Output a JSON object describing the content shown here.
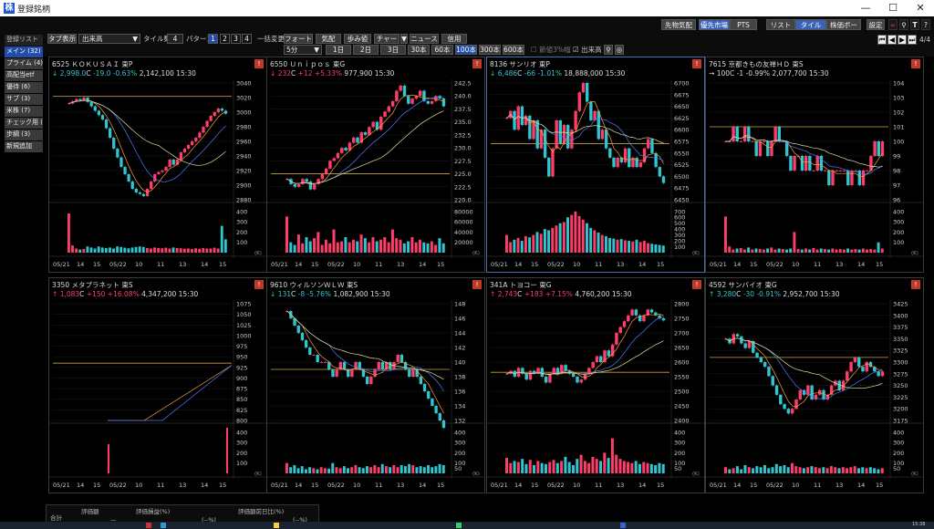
{
  "window": {
    "title": "登録銘柄",
    "minimize": "—",
    "maximize": "☐",
    "close": "✕"
  },
  "appbar": {
    "buttons": [
      "先物気配",
      "優先市場",
      "PTS",
      "リスト",
      "タイル",
      "株価ボード",
      "設定"
    ],
    "active": [
      "優先市場",
      "タイル"
    ],
    "page": "4/4"
  },
  "toolbar": {
    "tab_display_label": "タブ表示",
    "sort_value": "出来高",
    "tile_count_label": "タイル数",
    "tile_count": "4",
    "pattern_label": "パターン",
    "patterns": [
      "1",
      "2",
      "3",
      "4"
    ],
    "bulk_change_label": "一括変更",
    "row1_buttons": [
      "フォート",
      "気配",
      "歩み値",
      "チャート",
      "ニュース",
      "信用"
    ],
    "interval_value": "5分",
    "periods": [
      "1日",
      "2日",
      "3日",
      "30本",
      "60本",
      "100本",
      "300本",
      "600本"
    ],
    "active_period": "100本",
    "checkbox_ma": "節値3%幅",
    "checkbox_volume": "出来高"
  },
  "sidebar": {
    "header": "登録リスト",
    "items": [
      "メイン (32)",
      "プライム (4)",
      "高配当etf",
      "優待 (6)",
      "サブ (3)",
      "米株 (7)",
      "チェック用 (",
      "步綱 (3)"
    ],
    "active_index": 0,
    "add": "新規追加"
  },
  "panels": [
    {
      "code": "6525",
      "name": "ＫＯＫＵＳＡＩ",
      "market": "東P",
      "dir": "↓",
      "price": "2,998.0",
      "pc": "C",
      "change": "-19.0",
      "pct": "-0.63%",
      "volume": "2,142,100",
      "time": "15:30",
      "trend": "dn",
      "y_ticks": [
        "3040",
        "3020",
        "3000",
        "2980",
        "2960",
        "2940",
        "2920",
        "2900",
        "2880"
      ],
      "v_ticks": [
        "400",
        "300",
        "200",
        "100"
      ],
      "x_ticks": [
        "05/21",
        "14",
        "15",
        "05/22",
        "10",
        "11",
        "13",
        "14",
        "15"
      ],
      "base": 3022,
      "series": [
        3012,
        3015,
        3018,
        3016,
        3020,
        3014,
        3008,
        3002,
        2996,
        2990,
        2978,
        2965,
        2950,
        2938,
        2925,
        2915,
        2905,
        2895,
        2890,
        2888,
        2885,
        2895,
        2905,
        2915,
        2918,
        2920,
        2925,
        2935,
        2928,
        2935,
        2945,
        2950,
        2955,
        2960,
        2965,
        2972,
        2980,
        2988,
        2995,
        3000,
        3005,
        3002,
        2998
      ],
      "vols": [
        380,
        70,
        40,
        30,
        35,
        60,
        50,
        40,
        60,
        50,
        45,
        50,
        40,
        60,
        55,
        48,
        42,
        50,
        55,
        60,
        55,
        45,
        40,
        50,
        45,
        42,
        48,
        40,
        50,
        45,
        42,
        38,
        40,
        35,
        42,
        38,
        45,
        40,
        40,
        48,
        40,
        260,
        130
      ]
    },
    {
      "code": "6550",
      "name": "Ｕｎｉｐｏｓ",
      "market": "東G",
      "dir": "↓",
      "price": "232",
      "pc": "C",
      "change": "+12",
      "pct": "+5.33%",
      "volume": "977,900",
      "time": "15:30",
      "trend": "up",
      "y_ticks": [
        "242.5",
        "240.0",
        "237.5",
        "235.0",
        "232.5",
        "230.0",
        "227.5",
        "225.0",
        "222.5",
        "220.0"
      ],
      "v_ticks": [
        "80000",
        "60000",
        "40000",
        "20000"
      ],
      "x_ticks": [
        "05/21",
        "14",
        "15",
        "05/22",
        "10",
        "11",
        "13",
        "14",
        "15"
      ],
      "base": 225,
      "series": [
        224,
        223,
        222.5,
        223,
        224,
        223.5,
        222,
        223,
        224,
        225,
        226,
        227.5,
        228,
        229,
        230,
        229.5,
        231,
        232,
        231,
        233,
        232.5,
        234,
        235,
        233.5,
        236,
        237,
        238,
        239,
        241,
        242,
        240,
        238.5,
        239.5,
        240,
        241,
        239,
        238.5,
        239,
        240,
        239.5,
        238
      ],
      "vols": [
        70000,
        20000,
        15000,
        35000,
        18000,
        30000,
        22000,
        28000,
        40000,
        15000,
        25000,
        18000,
        45000,
        20000,
        22000,
        30000,
        20000,
        25000,
        22000,
        35000,
        28000,
        20000,
        30000,
        22000,
        25000,
        30000,
        20000,
        45000,
        28000,
        25000,
        18000,
        22000,
        30000,
        20000,
        25000,
        20000,
        18000,
        22000,
        15000,
        28000,
        18000
      ]
    },
    {
      "code": "8136",
      "name": "サンリオ",
      "market": "東P",
      "dir": "↓",
      "price": "6,486",
      "pc": "C",
      "change": "-66",
      "pct": "-1.01%",
      "volume": "18,888,000",
      "time": "15:30",
      "trend": "dn",
      "y_ticks": [
        "6700",
        "6675",
        "6650",
        "6625",
        "6600",
        "6575",
        "6550",
        "6525",
        "6500",
        "6475",
        "6450"
      ],
      "v_ticks": [
        "700",
        "600",
        "500",
        "400",
        "300",
        "200",
        "100"
      ],
      "x_ticks": [
        "05/21",
        "14",
        "15",
        "05/22",
        "10",
        "11",
        "13",
        "14",
        "15"
      ],
      "base": 6570,
      "series": [
        6625,
        6640,
        6600,
        6650,
        6610,
        6630,
        6580,
        6620,
        6560,
        6600,
        6540,
        6500,
        6560,
        6620,
        6570,
        6610,
        6560,
        6600,
        6640,
        6680,
        6700,
        6660,
        6620,
        6640,
        6580,
        6600,
        6560,
        6540,
        6520,
        6540,
        6530,
        6560,
        6520,
        6540,
        6520,
        6530,
        6560,
        6580,
        6550,
        6520,
        6500,
        6486
      ],
      "vols": [
        300,
        180,
        220,
        250,
        200,
        280,
        260,
        300,
        350,
        320,
        400,
        380,
        420,
        460,
        500,
        520,
        600,
        640,
        700,
        620,
        560,
        500,
        420,
        380,
        340,
        300,
        280,
        250,
        240,
        220,
        230,
        210,
        200,
        190,
        220,
        180,
        200,
        160,
        150,
        140,
        130,
        120
      ]
    },
    {
      "code": "7615",
      "name": "京都きもの友禅ＨＤ",
      "market": "東S",
      "dir": "→",
      "price": "100",
      "pc": "C",
      "change": "-1",
      "pct": "-0.99%",
      "volume": "2,077,700",
      "time": "15:30",
      "trend": "flat",
      "y_ticks": [
        "104",
        "103",
        "102",
        "101",
        "100",
        "99",
        "98",
        "97",
        "96"
      ],
      "v_ticks": [
        "400",
        "300",
        "200",
        "100"
      ],
      "x_ticks": [
        "05/21",
        "14",
        "15",
        "05/22",
        "10",
        "11",
        "13",
        "14",
        "15"
      ],
      "base": 101,
      "series": [
        100,
        100,
        101,
        100,
        100,
        101,
        100,
        100,
        99,
        100,
        100,
        99,
        100,
        101,
        100,
        100,
        99,
        98,
        99,
        99,
        98,
        99,
        98,
        98,
        99,
        98,
        98,
        97,
        98,
        98,
        98,
        98,
        97,
        98,
        98,
        97,
        98,
        98,
        99,
        100,
        99,
        100
      ],
      "vols": [
        350,
        60,
        30,
        40,
        45,
        30,
        50,
        30,
        40,
        35,
        30,
        40,
        50,
        30,
        40,
        35,
        30,
        40,
        200,
        35,
        30,
        40,
        30,
        45,
        30,
        40,
        35,
        30,
        40,
        30,
        35,
        30,
        40,
        30,
        35,
        30,
        40,
        30,
        35,
        30,
        100,
        40
      ]
    },
    {
      "code": "3350",
      "name": "メタプラネット",
      "market": "東S",
      "dir": "↑",
      "price": "1,083",
      "pc": "C",
      "change": "+150",
      "pct": "+16.08%",
      "volume": "4,347,200",
      "time": "15:30",
      "trend": "up",
      "y_ticks": [
        "1075",
        "1050",
        "1025",
        "1000",
        "975",
        "950",
        "925",
        "900",
        "875",
        "850",
        "825",
        "800"
      ],
      "v_ticks": [
        "400",
        "300",
        "200",
        "100"
      ],
      "x_ticks": [
        "05/21",
        "14",
        "15",
        "05/22",
        "10",
        "11",
        "13",
        "14",
        "15"
      ],
      "base": 935,
      "series": [],
      "vols": []
    },
    {
      "code": "9610",
      "name": "ウィルソンＷＬＷ",
      "market": "東S",
      "dir": "↓",
      "price": "131",
      "pc": "C",
      "change": "-8",
      "pct": "-5.76%",
      "volume": "1,082,900",
      "time": "15:30",
      "trend": "dn",
      "y_ticks": [
        "148",
        "146",
        "144",
        "142",
        "140",
        "138",
        "136",
        "134",
        "132"
      ],
      "v_ticks": [
        "400",
        "300",
        "200",
        "100",
        "50"
      ],
      "x_ticks": [
        "05/21",
        "14",
        "15",
        "05/22",
        "10",
        "11",
        "13",
        "14",
        "15"
      ],
      "base": 139,
      "series": [
        147,
        146,
        145,
        144,
        143,
        142,
        141,
        141,
        140,
        140,
        140,
        139,
        138,
        139,
        140,
        139,
        138,
        139,
        140,
        139,
        138,
        137,
        138,
        139,
        140,
        139,
        140,
        139,
        140,
        141,
        140,
        139,
        138,
        139,
        138,
        137,
        136,
        135,
        134,
        133,
        132,
        131
      ],
      "vols": [
        100,
        60,
        80,
        50,
        70,
        40,
        60,
        50,
        40,
        60,
        50,
        45,
        100,
        60,
        50,
        70,
        50,
        60,
        80,
        60,
        50,
        70,
        60,
        80,
        60,
        90,
        70,
        60,
        80,
        60,
        80,
        70,
        90,
        80,
        60,
        70,
        60,
        80,
        60,
        70,
        90,
        80
      ]
    },
    {
      "code": "341A",
      "name": "トヨコー",
      "market": "東G",
      "dir": "↑",
      "price": "2,743",
      "pc": "C",
      "change": "+183",
      "pct": "+7.15%",
      "volume": "4,760,200",
      "time": "15:30",
      "trend": "up",
      "y_ticks": [
        "2800",
        "2750",
        "2700",
        "2650",
        "2600",
        "2550",
        "2500",
        "2450",
        "2400"
      ],
      "v_ticks": [
        "400",
        "300",
        "200",
        "100",
        "50"
      ],
      "x_ticks": [
        "05/21",
        "14",
        "15",
        "05/22",
        "10",
        "11",
        "13",
        "14",
        "15"
      ],
      "base": 2565,
      "series": [
        2560,
        2570,
        2550,
        2580,
        2560,
        2540,
        2570,
        2560,
        2580,
        2550,
        2530,
        2560,
        2580,
        2560,
        2590,
        2570,
        2560,
        2550,
        2530,
        2540,
        2560,
        2580,
        2600,
        2620,
        2600,
        2640,
        2620,
        2660,
        2700,
        2720,
        2740,
        2760,
        2780,
        2760,
        2740,
        2760,
        2780,
        2770,
        2760,
        2750,
        2743
      ],
      "vols": [
        150,
        100,
        120,
        110,
        140,
        90,
        130,
        80,
        120,
        100,
        90,
        110,
        130,
        100,
        120,
        160,
        110,
        80,
        140,
        180,
        120,
        100,
        160,
        140,
        120,
        200,
        150,
        340,
        180,
        140,
        120,
        110,
        100,
        120,
        90,
        110,
        100,
        90,
        80,
        100,
        90
      ]
    },
    {
      "code": "4592",
      "name": "サンバイオ",
      "market": "東G",
      "dir": "↑",
      "price": "3,280",
      "pc": "C",
      "change": "-30",
      "pct": "-0.91%",
      "volume": "2,952,700",
      "time": "15:30",
      "trend": "dn",
      "y_ticks": [
        "3425",
        "3400",
        "3375",
        "3350",
        "3325",
        "3300",
        "3275",
        "3250",
        "3225",
        "3200",
        "3175"
      ],
      "v_ticks": [
        "400",
        "300",
        "200",
        "100",
        "50"
      ],
      "x_ticks": [
        "05/21",
        "14",
        "15",
        "05/22",
        "10",
        "11",
        "13",
        "14",
        "15"
      ],
      "base": 3310,
      "series": [
        3350,
        3340,
        3360,
        3355,
        3340,
        3330,
        3345,
        3320,
        3310,
        3300,
        3290,
        3270,
        3250,
        3230,
        3210,
        3200,
        3190,
        3200,
        3220,
        3240,
        3230,
        3250,
        3220,
        3230,
        3240,
        3220,
        3230,
        3250,
        3260,
        3240,
        3260,
        3280,
        3300,
        3310,
        3290,
        3280,
        3300,
        3290,
        3280,
        3270,
        3280
      ],
      "vols": [
        60,
        40,
        50,
        70,
        40,
        80,
        60,
        50,
        70,
        60,
        80,
        50,
        60,
        90,
        70,
        80,
        60,
        100,
        70,
        60,
        50,
        60,
        70,
        60,
        50,
        60,
        50,
        70,
        60,
        50,
        60,
        50,
        60,
        70,
        50,
        60,
        50,
        60,
        50,
        40,
        50
      ]
    }
  ],
  "footer": {
    "total_label": "合計",
    "col1": "評価額",
    "col2": "評価損益(%)",
    "col3": "評価額前日比(%)",
    "v1": "—",
    "v2": "(--%)",
    "v3": "(--%)"
  },
  "taskbar": {
    "clock": "15:38"
  }
}
